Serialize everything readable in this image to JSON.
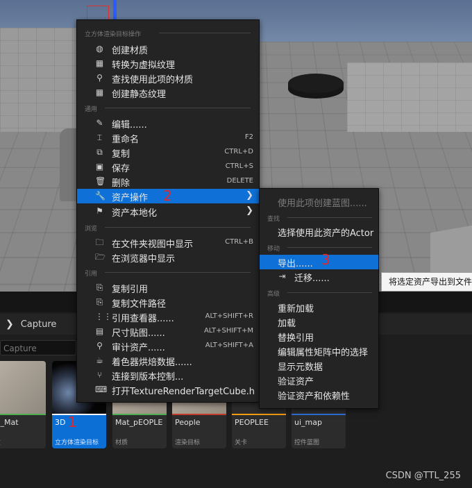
{
  "viewport": {},
  "content_browser": {
    "path": "Capture",
    "search_placeholder": "Capture",
    "assets": [
      {
        "name": "D_Mat",
        "type": "质",
        "bar_color": "#4caf50",
        "selected": false
      },
      {
        "name": "3D",
        "type": "立方体渲染目标",
        "bar_color": "#ffffff",
        "selected": true
      },
      {
        "name": "Mat_pEOPLE",
        "type": "材质",
        "bar_color": "#4caf50",
        "selected": false
      },
      {
        "name": "People",
        "type": "渲染目标",
        "bar_color": "#c0392b",
        "selected": false
      },
      {
        "name": "PEOPLEE",
        "type": "关卡",
        "bar_color": "#f39c12",
        "selected": false
      },
      {
        "name": "ui_map",
        "type": "控件蓝图",
        "bar_color": "#2e6fd6",
        "selected": false
      }
    ]
  },
  "main_menu": {
    "sections": {
      "cube_target": "立方体渲染目标操作",
      "general": "通用",
      "browse": "浏览",
      "references": "引用"
    },
    "items": {
      "create_material": {
        "label": "创建材质",
        "icon": "material-icon"
      },
      "convert_virtual": {
        "label": "转换为虚拟纹理",
        "icon": "checker-icon"
      },
      "find_material": {
        "label": "查找使用此项的材质",
        "icon": "search-icon"
      },
      "create_static": {
        "label": "创建静态纹理",
        "icon": "checker-icon"
      },
      "edit": {
        "label": "编辑......",
        "icon": "pencil-icon"
      },
      "rename": {
        "label": "重命名",
        "shortcut": "F2",
        "icon": "rename-icon"
      },
      "duplicate": {
        "label": "复制",
        "shortcut": "CTRL+D",
        "icon": "duplicate-icon"
      },
      "save": {
        "label": "保存",
        "shortcut": "CTRL+S",
        "icon": "save-icon"
      },
      "delete": {
        "label": "删除",
        "shortcut": "DELETE",
        "icon": "trash-icon"
      },
      "asset_actions": {
        "label": "资产操作",
        "icon": "wrench-icon"
      },
      "localization": {
        "label": "资产本地化",
        "icon": "flag-icon"
      },
      "show_in_folder": {
        "label": "在文件夹视图中显示",
        "shortcut": "CTRL+B",
        "icon": "folder-search-icon"
      },
      "show_in_explorer": {
        "label": "在浏览器中显示",
        "icon": "folder-icon"
      },
      "copy_reference": {
        "label": "复制引用",
        "icon": "copy-icon"
      },
      "copy_file_path": {
        "label": "复制文件路径",
        "icon": "copy-icon"
      },
      "reference_viewer": {
        "label": "引用查看器......",
        "shortcut": "ALT+SHIFT+R",
        "icon": "graph-icon"
      },
      "size_map": {
        "label": "尺寸贴图......",
        "shortcut": "ALT+SHIFT+M",
        "icon": "sizemap-icon"
      },
      "audit_assets": {
        "label": "审计资产......",
        "shortcut": "ALT+SHIFT+A",
        "icon": "audit-icon"
      },
      "shader_cook": {
        "label": "着色器烘焙数据......",
        "icon": "teapot-icon"
      },
      "source_control": {
        "label": "连接到版本控制...",
        "icon": "branch-icon"
      },
      "open_file": {
        "label": "打开TextureRenderTargetCube.h",
        "icon": "code-icon"
      }
    }
  },
  "sub_menu": {
    "create_blueprint": "使用此项创建蓝图......",
    "sections": {
      "find": "查找",
      "move": "移动",
      "advanced": "高级"
    },
    "select_actor": "选择使用此资产的Actor",
    "export": "导出......",
    "migrate": "迁移......",
    "reimport": "重新加载",
    "load": "加载",
    "replace_refs": "替换引用",
    "edit_matrix": "编辑属性矩阵中的选择",
    "show_metadata": "显示元数据",
    "validate": "验证资产",
    "validate_deps": "验证资产和依赖性"
  },
  "tooltip": "将选定资产导出到文件",
  "markers": [
    "1",
    "2",
    "3"
  ],
  "watermark": "CSDN @TTL_255"
}
